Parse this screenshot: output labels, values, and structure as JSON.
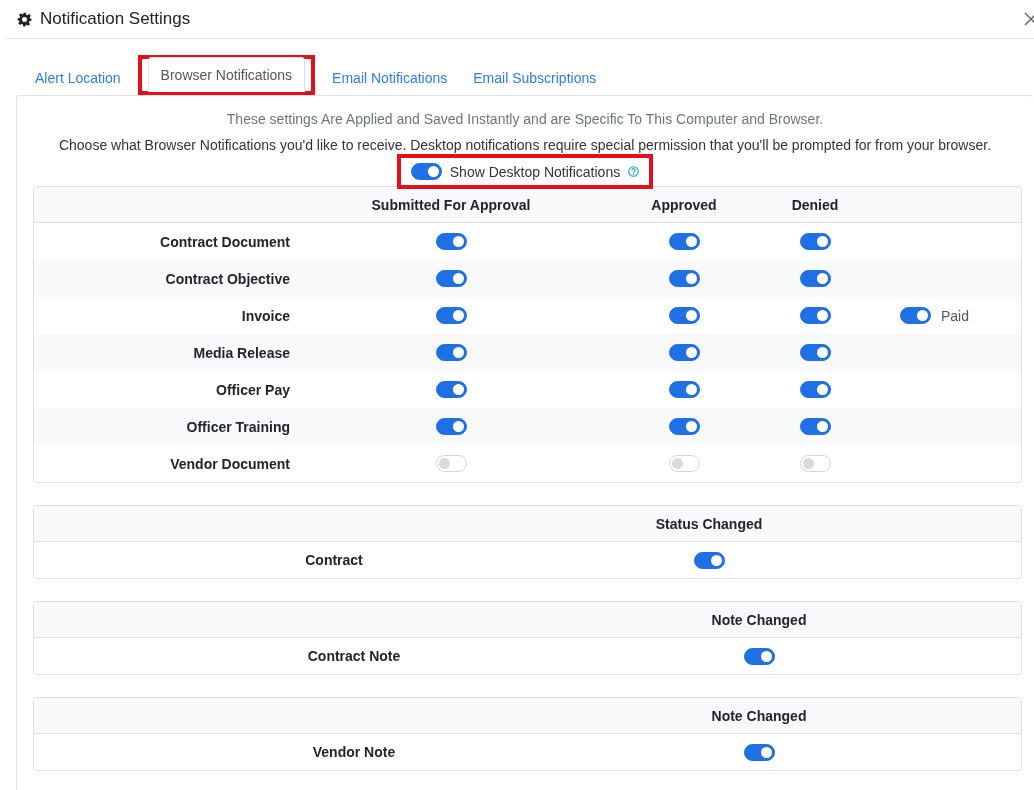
{
  "dialog": {
    "title": "Notification Settings"
  },
  "tabs": [
    {
      "label": "Alert Location",
      "selected": false,
      "highlighted": false
    },
    {
      "label": "Browser Notifications",
      "selected": true,
      "highlighted": true
    },
    {
      "label": "Email Notifications",
      "selected": false,
      "highlighted": false
    },
    {
      "label": "Email Subscriptions",
      "selected": false,
      "highlighted": false
    }
  ],
  "notice": "These settings Are Applied and Saved Instantly and are Specific To This Computer and Browser.",
  "intro": "Choose what Browser Notifications you'd like to receive. Desktop notifications require special permission that you'll be prompted for from your browser.",
  "desktop_toggle": {
    "label": "Show Desktop Notifications",
    "on": true,
    "highlighted": true
  },
  "tables": [
    {
      "kind": "matrix",
      "columns": [
        "Submitted For Approval",
        "Approved",
        "Denied"
      ],
      "rows": [
        {
          "label": "Contract Document",
          "toggles": [
            {
              "on": true
            },
            {
              "on": true
            },
            {
              "on": true
            }
          ]
        },
        {
          "label": "Contract Objective",
          "toggles": [
            {
              "on": true
            },
            {
              "on": true
            },
            {
              "on": true
            }
          ]
        },
        {
          "label": "Invoice",
          "toggles": [
            {
              "on": true
            },
            {
              "on": true
            },
            {
              "on": true
            }
          ],
          "extra": {
            "label": "Paid",
            "on": true
          }
        },
        {
          "label": "Media Release",
          "toggles": [
            {
              "on": true
            },
            {
              "on": true
            },
            {
              "on": true
            }
          ]
        },
        {
          "label": "Officer Pay",
          "toggles": [
            {
              "on": true
            },
            {
              "on": true
            },
            {
              "on": true
            }
          ]
        },
        {
          "label": "Officer Training",
          "toggles": [
            {
              "on": true
            },
            {
              "on": true
            },
            {
              "on": true
            }
          ]
        },
        {
          "label": "Vendor Document",
          "toggles": [
            {
              "on": false
            },
            {
              "on": false
            },
            {
              "on": false
            }
          ]
        }
      ]
    },
    {
      "kind": "simple",
      "columns": [
        "Status Changed"
      ],
      "rows": [
        {
          "label": "Contract",
          "toggles": [
            {
              "on": true
            }
          ]
        }
      ]
    },
    {
      "kind": "simple",
      "columns": [
        "Note Changed"
      ],
      "rows": [
        {
          "label": "Contract Note",
          "toggles": [
            {
              "on": true
            }
          ]
        }
      ]
    },
    {
      "kind": "simple",
      "columns": [
        "Note Changed"
      ],
      "rows": [
        {
          "label": "Vendor Note",
          "toggles": [
            {
              "on": true
            }
          ]
        }
      ]
    }
  ]
}
